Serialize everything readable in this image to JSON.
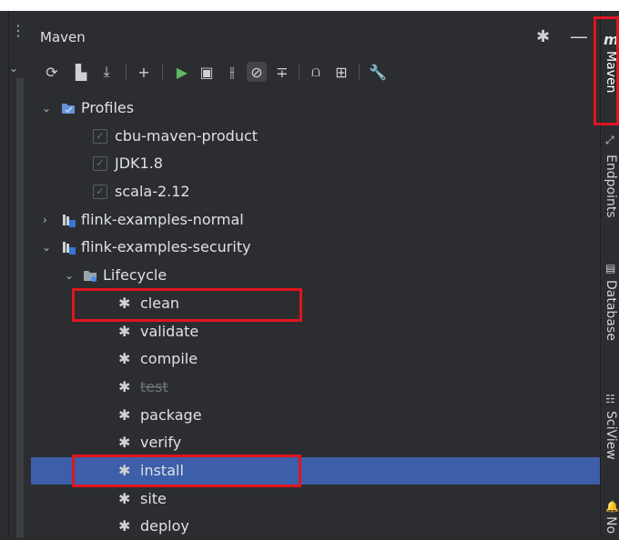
{
  "panel": {
    "title": "Maven"
  },
  "tree": {
    "profiles_label": "Profiles",
    "profiles": [
      {
        "label": "cbu-maven-product",
        "checked": true
      },
      {
        "label": "JDK1.8",
        "checked": true
      },
      {
        "label": "scala-2.12",
        "checked": true
      }
    ],
    "project_normal": "flink-examples-normal",
    "project_security": "flink-examples-security",
    "lifecycle_label": "Lifecycle",
    "goals": [
      "clean",
      "validate",
      "compile",
      "test",
      "package",
      "verify",
      "install",
      "site",
      "deploy"
    ],
    "selected_goal": "install",
    "disabled_goal": "test"
  },
  "rightbar": {
    "logo": "m",
    "tabs": [
      "Maven",
      "Endpoints",
      "Database",
      "SciView",
      "No"
    ]
  },
  "colors": {
    "selection": "#3d5ea8",
    "highlight_box": "#e0141e",
    "run_green": "#5fb865"
  }
}
